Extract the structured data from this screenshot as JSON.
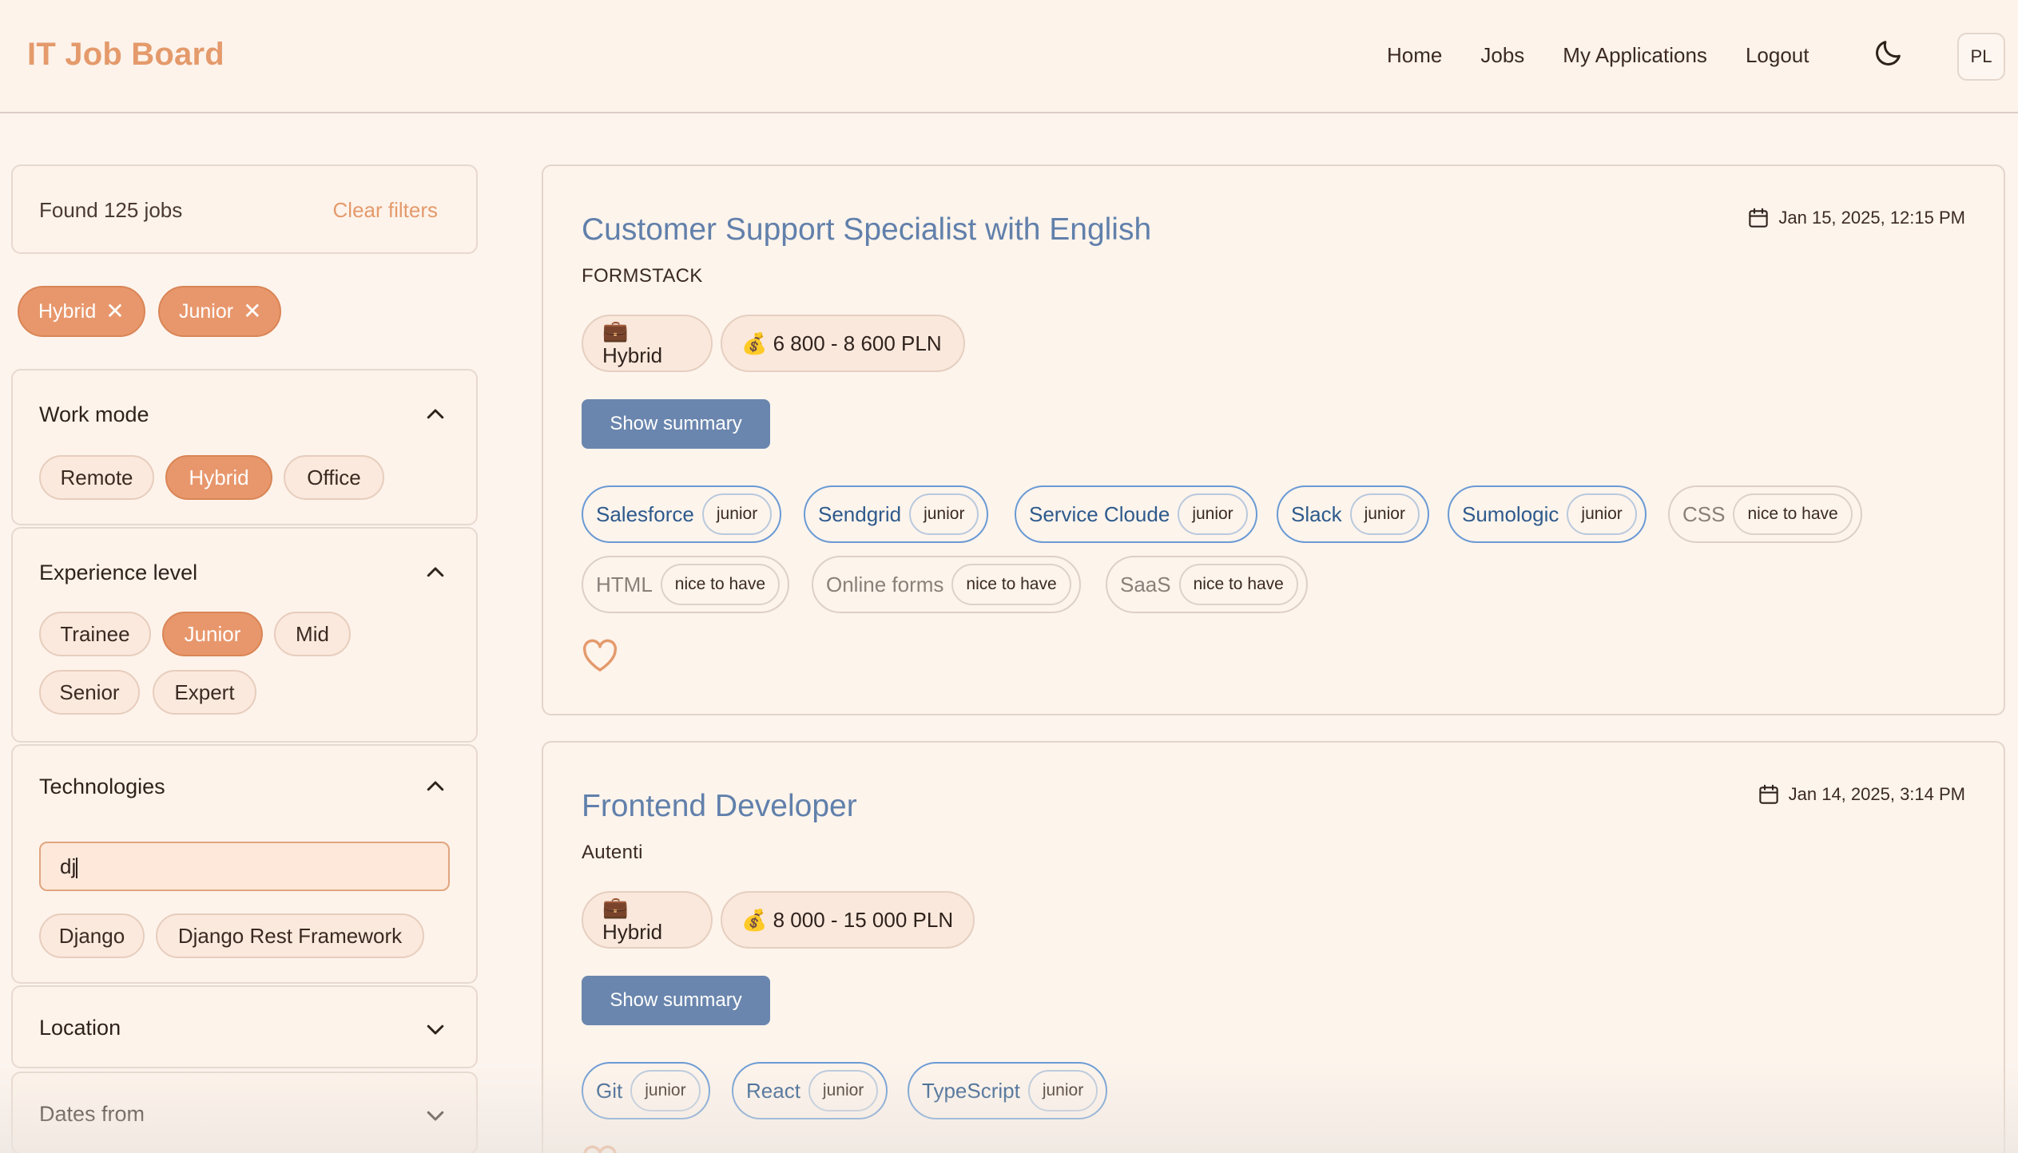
{
  "app": {
    "brand": "IT Job Board"
  },
  "nav": {
    "items": [
      "Home",
      "Jobs",
      "My Applications",
      "Logout"
    ],
    "language": "PL",
    "theme_icon": "moon-icon"
  },
  "filters": {
    "found": "Found 125 jobs",
    "clear": "Clear filters",
    "active": [
      "Hybrid",
      "Junior"
    ],
    "work_mode": {
      "title": "Work mode",
      "options": [
        "Remote",
        "Hybrid",
        "Office"
      ],
      "selected": "Hybrid"
    },
    "experience": {
      "title": "Experience level",
      "options": [
        "Trainee",
        "Junior",
        "Mid",
        "Senior",
        "Expert"
      ],
      "selected": "Junior"
    },
    "technologies": {
      "title": "Technologies",
      "input_value": "dj",
      "suggestions": [
        "Django",
        "Django Rest Framework"
      ]
    },
    "location": {
      "title": "Location"
    },
    "dates": {
      "title": "Dates from"
    }
  },
  "jobs": [
    {
      "title": "Customer Support Specialist with English",
      "company": "FORMSTACK",
      "date": "Jan 15, 2025, 12:15 PM",
      "mode": "💼 Hybrid",
      "salary": "💰 6 800 - 8 600 PLN",
      "summary_label": "Show summary",
      "required": [
        {
          "name": "Salesforce",
          "level": "junior"
        },
        {
          "name": "Sendgrid",
          "level": "junior"
        },
        {
          "name": "Service Cloude",
          "level": "junior"
        },
        {
          "name": "Slack",
          "level": "junior"
        },
        {
          "name": "Sumologic",
          "level": "junior"
        }
      ],
      "nice": [
        {
          "name": "CSS",
          "level": "nice to have"
        },
        {
          "name": "HTML",
          "level": "nice to have"
        },
        {
          "name": "Online forms",
          "level": "nice to have"
        },
        {
          "name": "SaaS",
          "level": "nice to have"
        }
      ]
    },
    {
      "title": "Frontend Developer",
      "company": "Autenti",
      "date": "Jan 14, 2025, 3:14 PM",
      "mode": "💼 Hybrid",
      "salary": "💰 8 000 - 15 000 PLN",
      "summary_label": "Show summary",
      "required": [
        {
          "name": "Git",
          "level": "junior"
        },
        {
          "name": "React",
          "level": "junior"
        },
        {
          "name": "TypeScript",
          "level": "junior"
        }
      ]
    }
  ],
  "colors": {
    "accent": "#e8976c",
    "link": "#6180ab",
    "button": "#6a86ae",
    "background": "#fdf4ee"
  }
}
